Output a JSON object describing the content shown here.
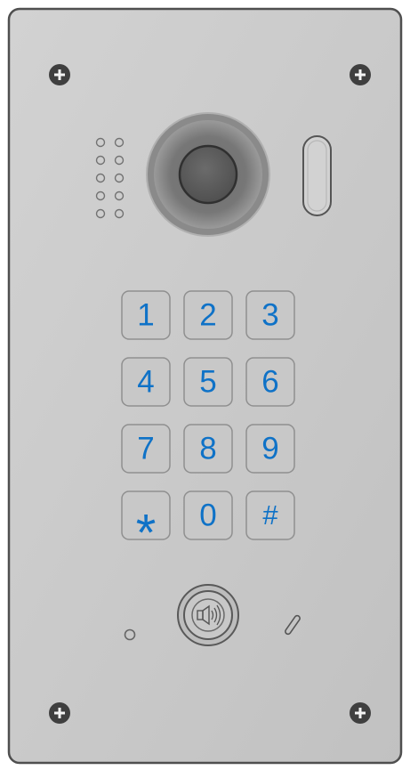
{
  "keypad": {
    "keys": [
      "1",
      "2",
      "3",
      "4",
      "5",
      "6",
      "7",
      "8",
      "9",
      "*",
      "0",
      "#"
    ]
  },
  "colors": {
    "panel": "#c8c8c8",
    "panel_border": "#5f5f5f",
    "key_text": "#0f72c7",
    "screw": "#3f3f3f",
    "camera_outer": "#7b7b7b",
    "camera_inner": "#5f5f5f"
  },
  "icons": {
    "speaker": "speaker-icon",
    "screw": "screw-icon",
    "camera": "camera-icon",
    "microphone": "microphone-hole-icon",
    "card_slot": "rfid-slot-icon"
  }
}
